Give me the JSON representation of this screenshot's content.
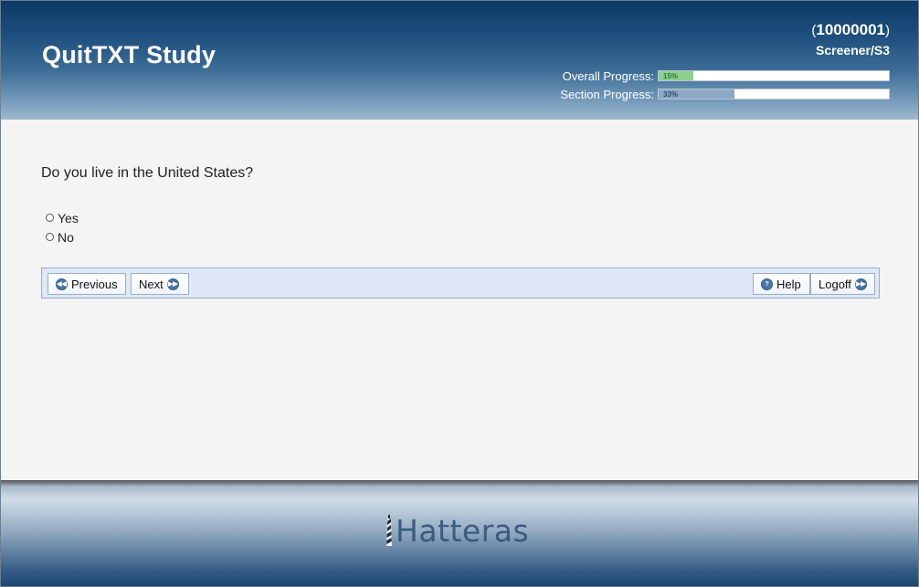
{
  "header": {
    "title": "QuitTXT Study",
    "participant_id_open": "(",
    "participant_id": "10000001",
    "participant_id_close": ")",
    "screen_name": "Screener/S3",
    "overall_progress": {
      "label": "Overall Progress:",
      "percent_text": "15%",
      "value": 15,
      "color": "#8ccf8e"
    },
    "section_progress": {
      "label": "Section Progress:",
      "percent_text": "33%",
      "value": 33,
      "color": "#8ea9c5"
    }
  },
  "main": {
    "question": "Do you live in the United States?",
    "options": [
      {
        "label": "Yes"
      },
      {
        "label": "No"
      }
    ]
  },
  "nav": {
    "previous_label": "Previous",
    "next_label": "Next",
    "help_label": "Help",
    "logoff_label": "Logoff"
  },
  "footer": {
    "logo_text": "Hatteras"
  },
  "colors": {
    "header_dark": "#0d3a66",
    "navbar_bg": "#dfe8f6",
    "page_bg": "#f4f4f4"
  }
}
